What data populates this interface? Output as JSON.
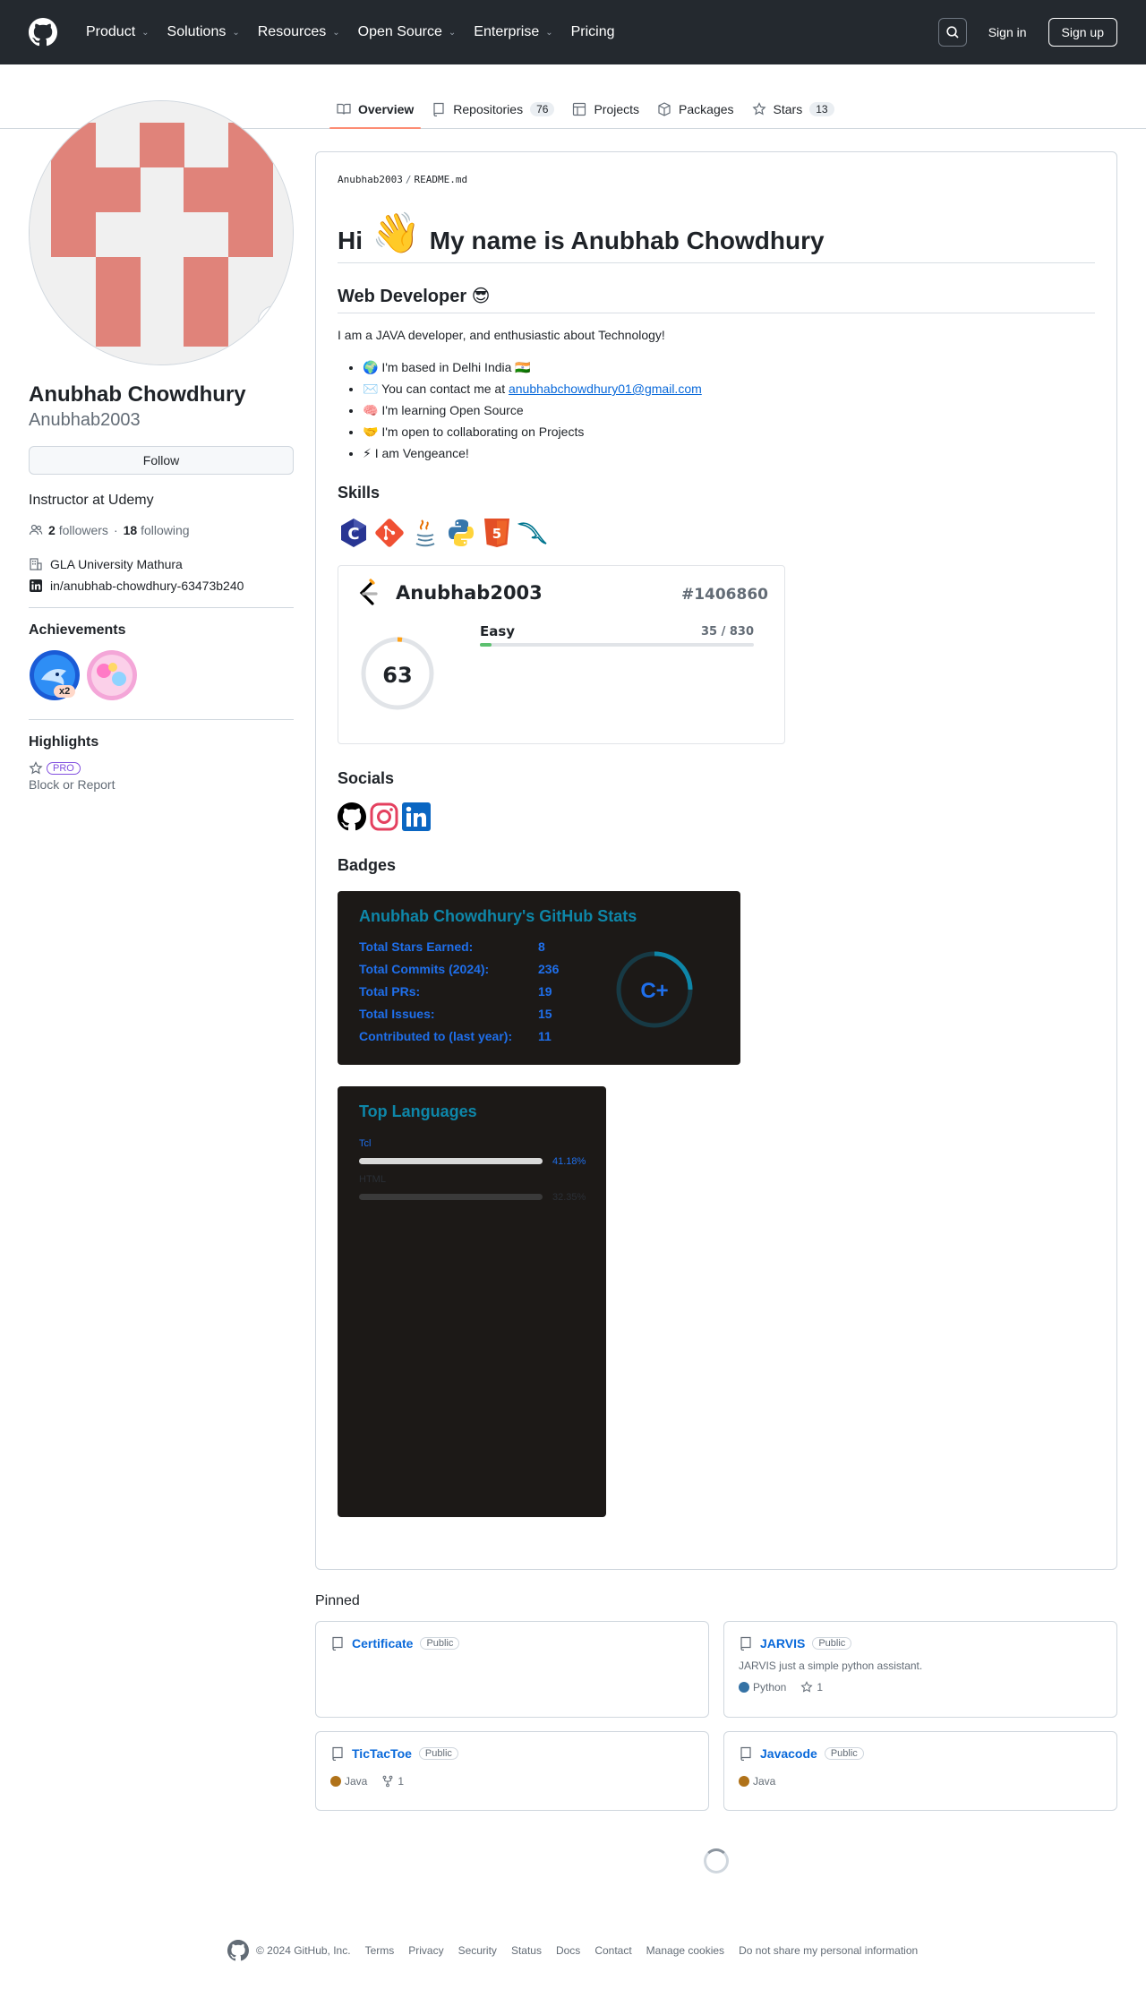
{
  "header": {
    "nav": [
      "Product",
      "Solutions",
      "Resources",
      "Open Source",
      "Enterprise",
      "Pricing"
    ],
    "sign_in": "Sign in",
    "sign_up": "Sign up"
  },
  "tabs": [
    {
      "label": "Overview",
      "count": null
    },
    {
      "label": "Repositories",
      "count": "76"
    },
    {
      "label": "Projects",
      "count": null
    },
    {
      "label": "Packages",
      "count": null
    },
    {
      "label": "Stars",
      "count": "13"
    }
  ],
  "profile": {
    "name": "Anubhab Chowdhury",
    "login": "Anubhab2003",
    "follow_label": "Follow",
    "bio": "Instructor at Udemy",
    "followers_count": "2",
    "followers_label": "followers",
    "following_count": "18",
    "following_label": "following",
    "organization": "GLA University Mathura",
    "linkedin": "in/anubhab-chowdhury-63473b240"
  },
  "achievements": {
    "title": "Achievements",
    "count_badge": "x2"
  },
  "highlights": {
    "title": "Highlights",
    "pro": "PRO",
    "block": "Block or Report"
  },
  "readme": {
    "path_user": "Anubhab2003",
    "path_file": "README.md",
    "h1_pre": "Hi",
    "h1_wave": "👋",
    "h1_post": "My name is Anubhab Chowdhury",
    "h2": "Web Developer 😎",
    "intro": "I am a JAVA developer, and enthusiastic about Technology!",
    "list": [
      "🌍  I'm based in Delhi India 🇮🇳",
      "🧠  I'm learning Open Source",
      "🤝  I'm open to collaborating on Projects",
      "⚡  I am Vengeance!"
    ],
    "contact_prefix": "✉️  You can contact me at",
    "contact_email": "anubhabchowdhury01@gmail.com",
    "skills_title": "Skills",
    "socials_title": "Socials",
    "badges_title": "Badges"
  },
  "leetcode": {
    "username": "Anubhab2003",
    "rank": "#1406860",
    "solved": "63",
    "easy_label": "Easy",
    "easy_count": "35 / 830",
    "easy_fraction": 0.042
  },
  "github_stats": {
    "title": "Anubhab Chowdhury's GitHub Stats",
    "rows": [
      {
        "label": "Total Stars Earned:",
        "value": "8"
      },
      {
        "label": "Total Commits (2024):",
        "value": "236"
      },
      {
        "label": "Total PRs:",
        "value": "19"
      },
      {
        "label": "Total Issues:",
        "value": "15"
      },
      {
        "label": "Contributed to (last year):",
        "value": "11"
      }
    ],
    "grade": "C+"
  },
  "top_languages": {
    "title": "Top Languages",
    "items": [
      {
        "name": "Tcl",
        "percent": "41.18%",
        "fraction": 0.4118,
        "color": "#e4cc98"
      },
      {
        "name": "HTML",
        "percent": "32.35%",
        "fraction": 0.3235,
        "color": "#e34c26"
      }
    ]
  },
  "pinned": {
    "title": "Pinned",
    "repos": [
      {
        "name": "Certificate",
        "visibility": "Public",
        "description": "",
        "language": "",
        "lang_color": "",
        "stars": "",
        "forks": ""
      },
      {
        "name": "JARVIS",
        "visibility": "Public",
        "description": "JARVIS just a simple python assistant.",
        "language": "Python",
        "lang_color": "#3572A5",
        "stars": "1",
        "forks": ""
      },
      {
        "name": "TicTacToe",
        "visibility": "Public",
        "description": "",
        "language": "Java",
        "lang_color": "#b07219",
        "stars": "",
        "forks": "1"
      },
      {
        "name": "Javacode",
        "visibility": "Public",
        "description": "",
        "language": "Java",
        "lang_color": "#b07219",
        "stars": "",
        "forks": ""
      }
    ]
  },
  "footer": {
    "copyright": "© 2024 GitHub, Inc.",
    "links": [
      "Terms",
      "Privacy",
      "Security",
      "Status",
      "Docs",
      "Contact",
      "Manage cookies",
      "Do not share my personal information"
    ]
  }
}
